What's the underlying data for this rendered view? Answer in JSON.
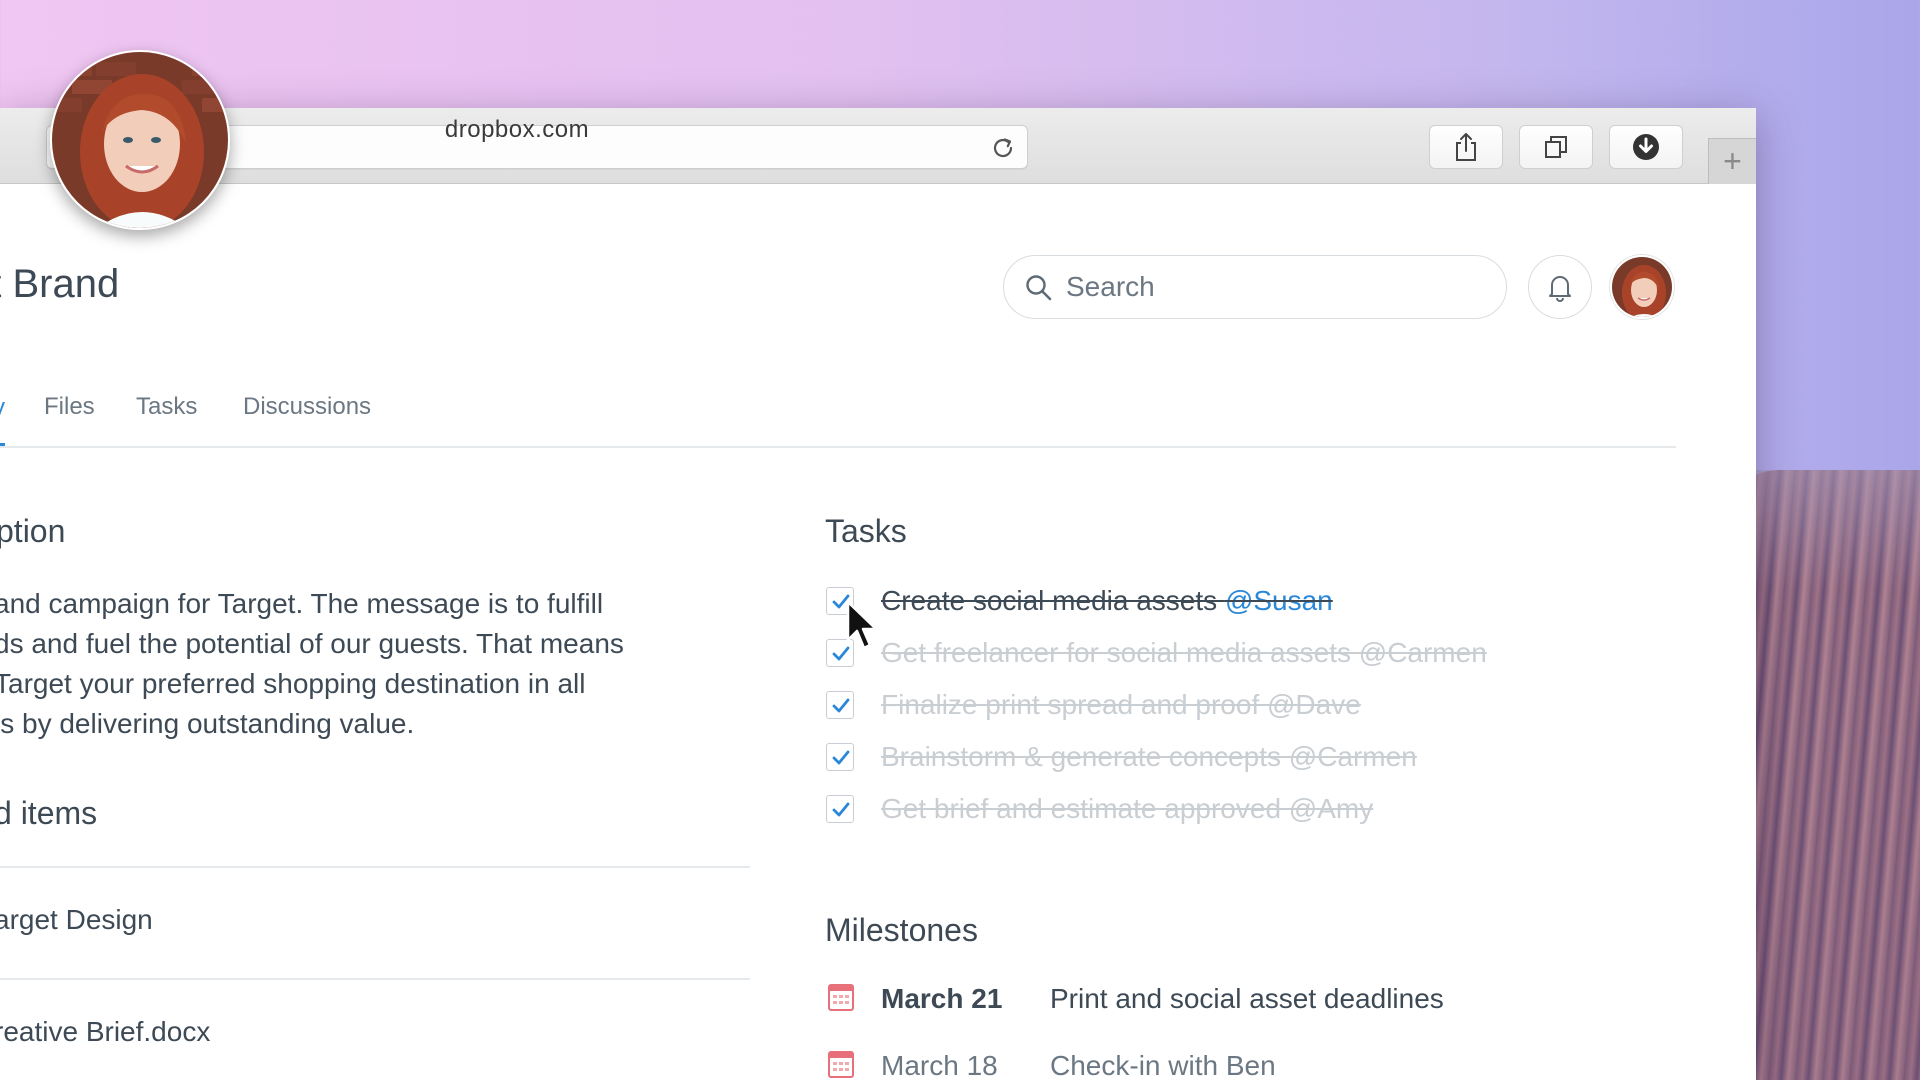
{
  "browser": {
    "url": "dropbox.com",
    "newtab_label": "+"
  },
  "header": {
    "title": "et Brand",
    "search_placeholder": "Search"
  },
  "tabs": [
    {
      "label": "y"
    },
    {
      "label": "Files"
    },
    {
      "label": "Tasks"
    },
    {
      "label": "Discussions"
    }
  ],
  "description": {
    "heading": "ption",
    "lines": [
      "and campaign for Target. The message is to fulfill",
      "ds and fuel the potential of our guests. That means",
      " Target your preferred shopping destination in all",
      "ls by delivering outstanding value."
    ]
  },
  "related": {
    "heading": "d items",
    "items": [
      {
        "label": "arget Design"
      },
      {
        "label": "reative Brief.docx"
      }
    ]
  },
  "tasks": {
    "heading": "Tasks",
    "items": [
      {
        "text": "Create social media assets ",
        "mention": "@Susan",
        "checked": true
      },
      {
        "text": "Get freelancer for social media assets @Carmen",
        "checked": true
      },
      {
        "text": "Finalize print spread and proof @Dave",
        "checked": true
      },
      {
        "text": "Brainstorm & generate concepts @Carmen",
        "checked": true
      },
      {
        "text": "Get brief and estimate approved @Amy",
        "checked": true
      }
    ]
  },
  "milestones": {
    "heading": "Milestones",
    "items": [
      {
        "date": "March 21",
        "text": "Print and social asset deadlines"
      },
      {
        "date": "March 18",
        "text": "Check-in with Ben"
      }
    ]
  },
  "colors": {
    "accent": "#2b88d9",
    "text": "#3d4a55",
    "muted": "#6b7782",
    "faded": "#c9ced3",
    "calendar": "#e8707a"
  },
  "icons": [
    "reload-icon",
    "share-icon",
    "tabs-icon",
    "download-icon",
    "search-icon",
    "bell-icon",
    "check-icon",
    "calendar-icon",
    "cursor-icon"
  ]
}
